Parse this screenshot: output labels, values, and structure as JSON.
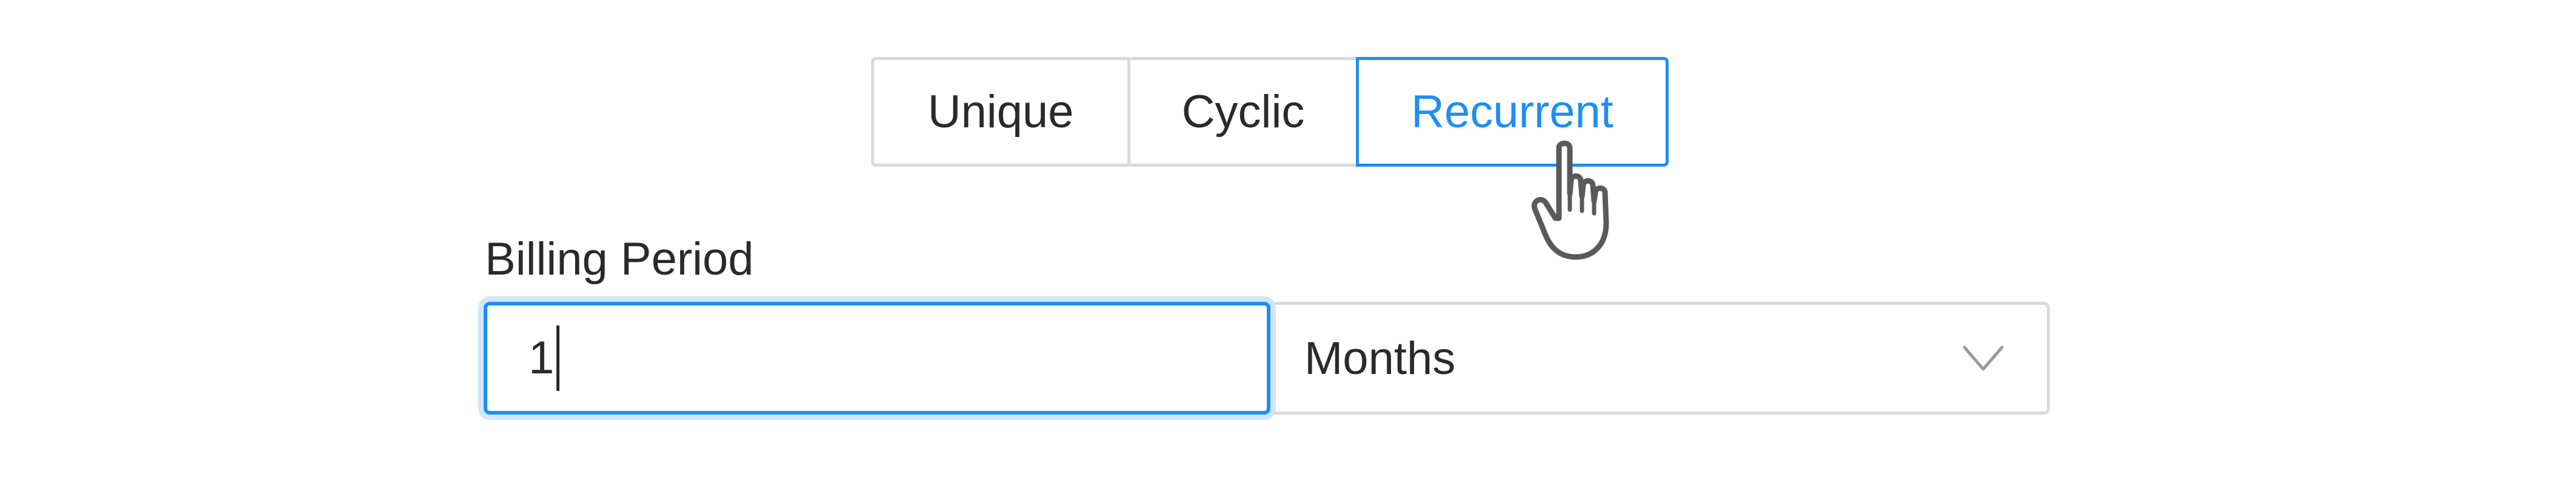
{
  "tabs": [
    {
      "label": "Unique",
      "selected": false
    },
    {
      "label": "Cyclic",
      "selected": false
    },
    {
      "label": "Recurrent",
      "selected": true
    }
  ],
  "billing": {
    "label": "Billing Period",
    "value": "1",
    "unit": "Months"
  },
  "icons": {
    "cursor": "hand-pointer-icon",
    "dropdown": "chevron-down-icon"
  },
  "colors": {
    "accent": "#1e8ff0",
    "focus_ring": "#cfe6fb",
    "border": "#d9d9d9",
    "text": "#2a2a2a"
  }
}
